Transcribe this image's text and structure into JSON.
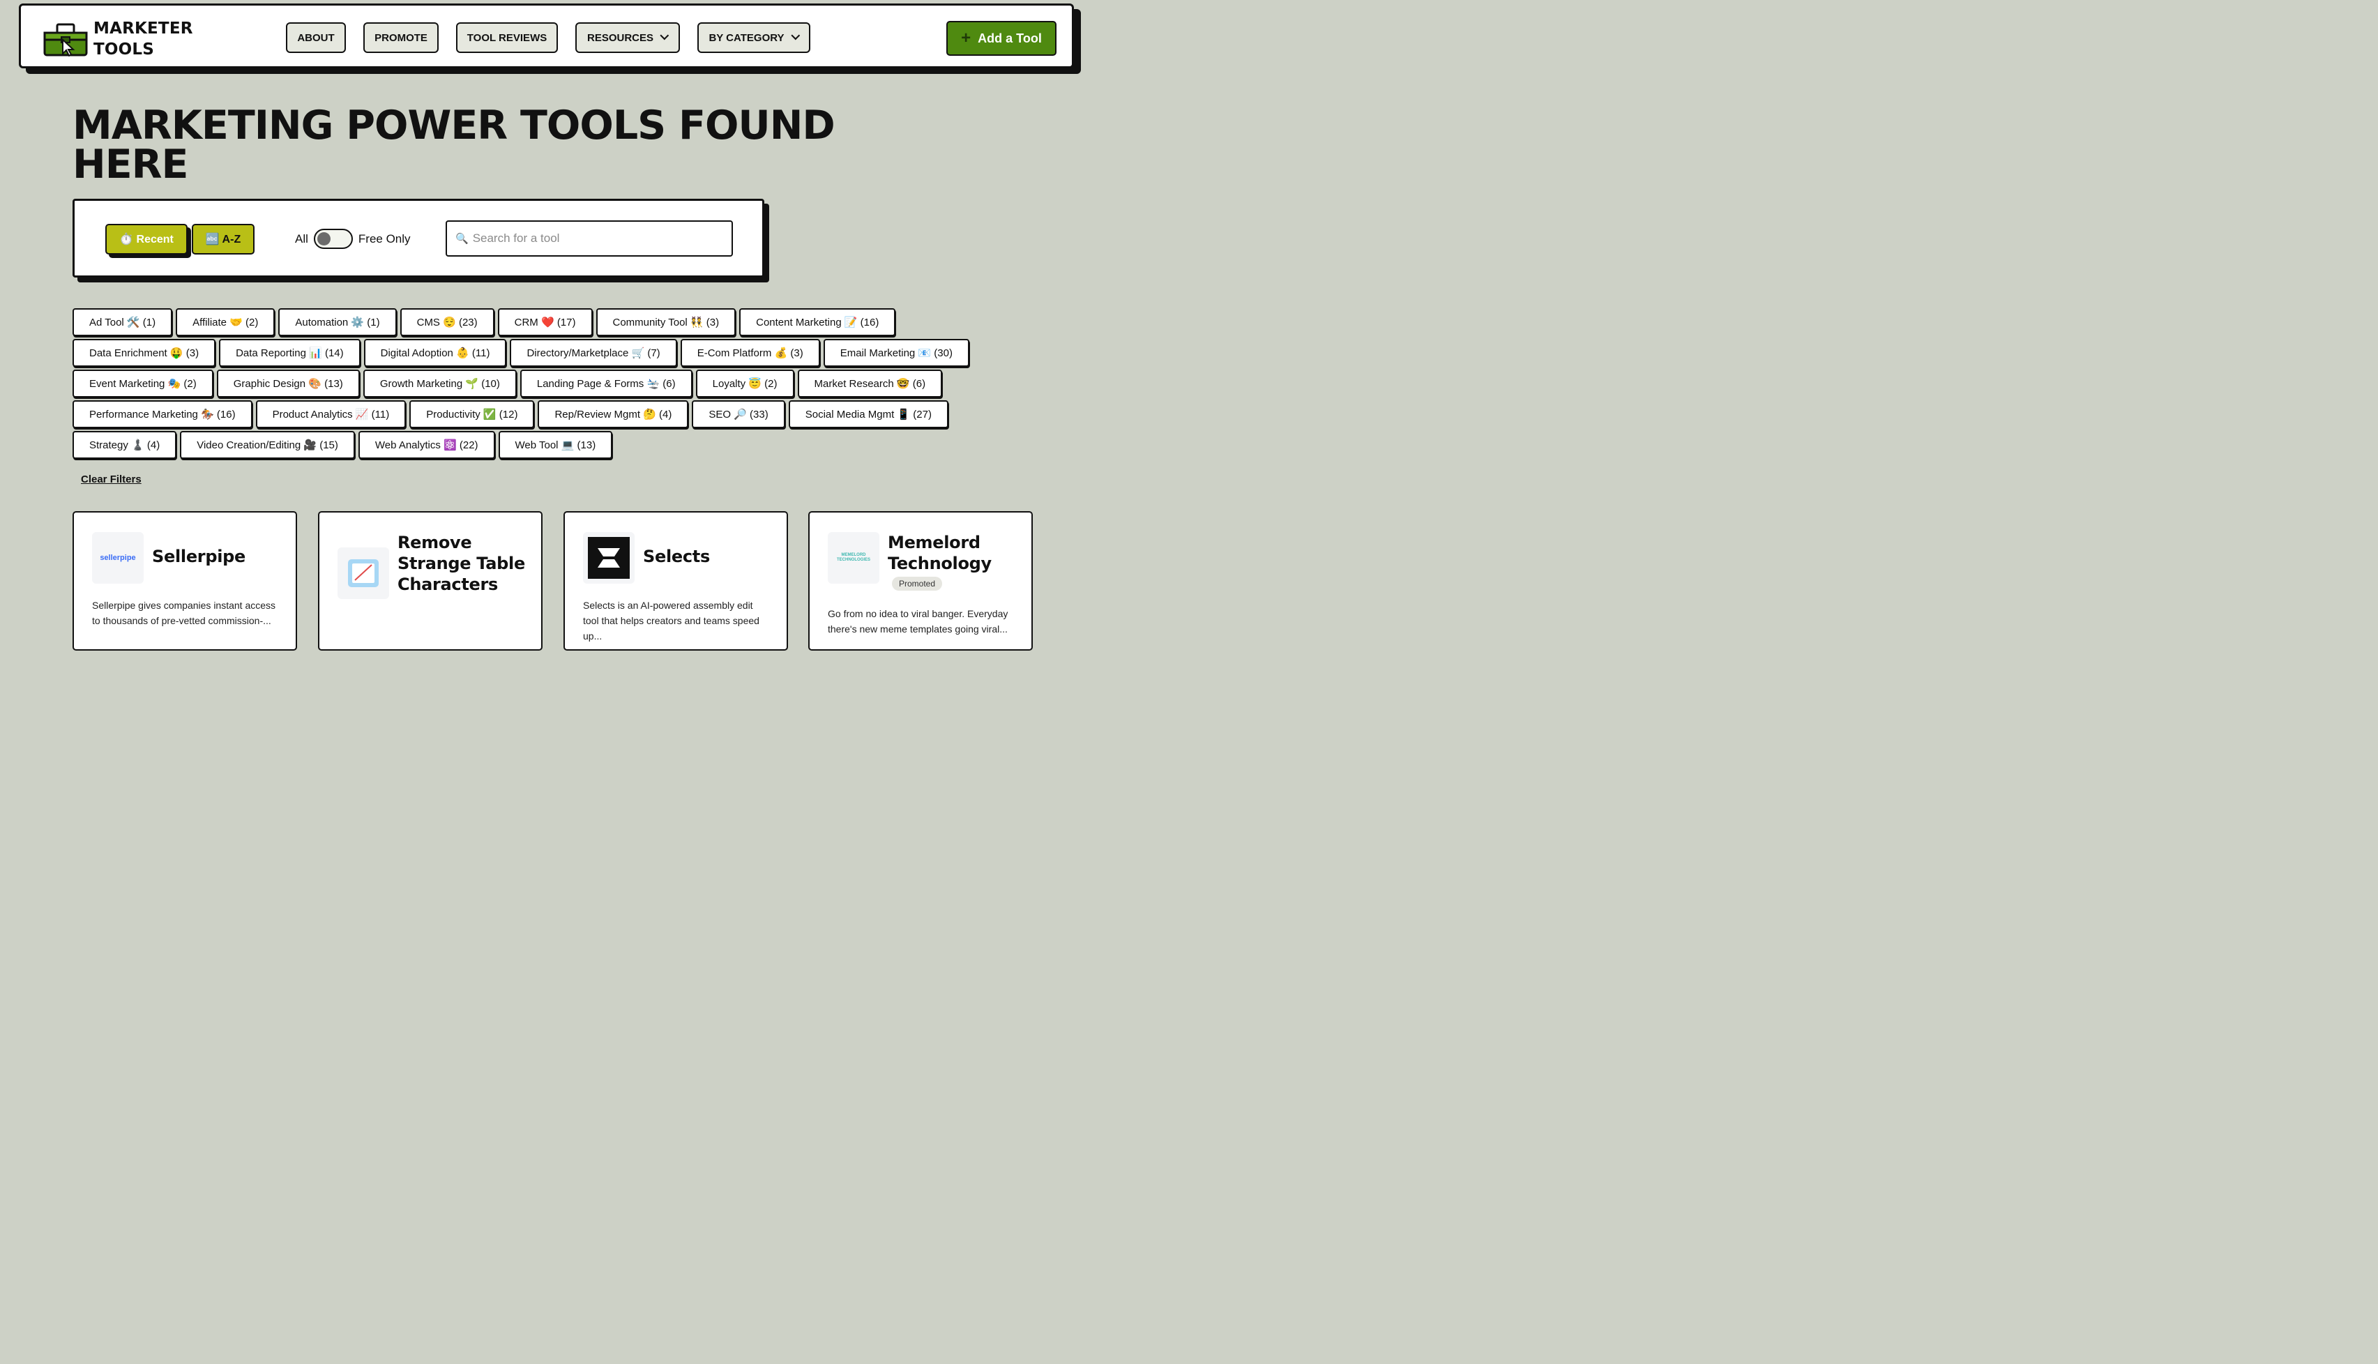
{
  "nav": {
    "logo_line1": "MARKETER",
    "logo_line2": "TOOLS",
    "items": [
      {
        "label": "ABOUT"
      },
      {
        "label": "PROMOTE"
      },
      {
        "label": "TOOL REVIEWS"
      },
      {
        "label": "RESOURCES",
        "dropdown": true
      },
      {
        "label": "BY CATEGORY",
        "dropdown": true
      }
    ],
    "add_label": "Add a Tool",
    "add_icon": "plus-icon",
    "accent_color": "#4f8a10"
  },
  "hero": {
    "title_line1": "MARKETING POWER TOOLS FOUND",
    "title_line2": "HERE"
  },
  "filters": {
    "recent_label": "⏱️ Recent",
    "az_label": "🔤 A-Z",
    "toggle_left": "All",
    "toggle_right": "Free Only",
    "toggle_on": false,
    "search_icon": "🔍",
    "search_placeholder": "Search for a tool",
    "search_value": "",
    "sort_color": "#b9bf16"
  },
  "categories": [
    "Ad Tool 🛠️ (1)",
    "Affiliate 🤝 (2)",
    "Automation ⚙️ (1)",
    "CMS 😌 (23)",
    "CRM ❤️ (17)",
    "Community Tool 👯 (3)",
    "Content Marketing 📝 (16)",
    "Data Enrichment 🤑 (3)",
    "Data Reporting 📊 (14)",
    "Digital Adoption 👶 (11)",
    "Directory/Marketplace 🛒 (7)",
    "E-Com Platform 💰 (3)",
    "Email Marketing 📧 (30)",
    "Event Marketing 🎭 (2)",
    "Graphic Design 🎨 (13)",
    "Growth Marketing 🌱 (10)",
    "Landing Page & Forms 🛬 (6)",
    "Loyalty 😇 (2)",
    "Market Research 🤓 (6)",
    "Performance Marketing 🏇 (16)",
    "Product Analytics 📈 (11)",
    "Productivity ✅ (12)",
    "Rep/Review Mgmt 🤔 (4)",
    "SEO 🔎 (33)",
    "Social Media Mgmt 📱 (27)",
    "Strategy ♟️ (4)",
    "Video Creation/Editing 🎥 (15)",
    "Web Analytics ⚛️ (22)",
    "Web Tool 💻 (13)"
  ],
  "clear_label": "Clear Filters",
  "cards": [
    {
      "name": "Sellerpipe",
      "logo_text": "sellerpipe",
      "desc": "Sellerpipe gives companies instant access to thousands of pre-vetted commission-..."
    },
    {
      "name": "Remove Strange Table Characters",
      "desc": ""
    },
    {
      "name": "Selects",
      "desc": "Selects is an AI-powered assembly edit tool that helps creators and teams speed up..."
    },
    {
      "name": "Memelord Technology",
      "logo_text": "MEMELORD TECHNOLOGIES",
      "badge": "Promoted",
      "desc": "Go from no idea to viral banger. Everyday there's new meme templates going viral..."
    }
  ]
}
